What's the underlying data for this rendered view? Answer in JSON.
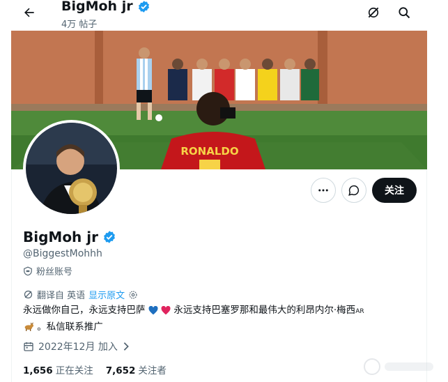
{
  "header": {
    "name": "BigMoh jr",
    "post_count": "4万 帖子"
  },
  "profile": {
    "display_name": "BigMoh jr",
    "handle": "@BiggestMohhh",
    "fan_label": "粉丝账号",
    "jersey_text": "RONALDO"
  },
  "translation": {
    "translated_from": "翻译自 英语",
    "show_original": "显示原文"
  },
  "bio": {
    "part1": "永远做你自己，永远支持巴萨",
    "part2": "永远支持巴塞罗那和最伟大的利昂内尔·梅西",
    "ar_tag": "AR",
    "part3": "。私信联系推广"
  },
  "joined": {
    "text": "2022年12月 加入"
  },
  "stats": {
    "following_count": "1,656",
    "following_label": "正在关注",
    "followers_count": "7,652",
    "followers_label": "关注者"
  },
  "buttons": {
    "follow_label": "关注"
  },
  "colors": {
    "verified_blue": "#1d9bf0",
    "follow_bg": "#0f1419",
    "link_blue": "#1d9bf0",
    "secondary_text": "#536471"
  },
  "icons": {
    "back": "arrow-left-icon",
    "grok": "grok-icon",
    "search": "search-icon",
    "verified": "verified-badge-icon",
    "more": "more-icon",
    "message": "message-icon",
    "fan": "fan-account-icon",
    "translate": "translate-icon",
    "settings": "gear-icon",
    "calendar": "calendar-icon",
    "chevron": "chevron-right-icon"
  }
}
